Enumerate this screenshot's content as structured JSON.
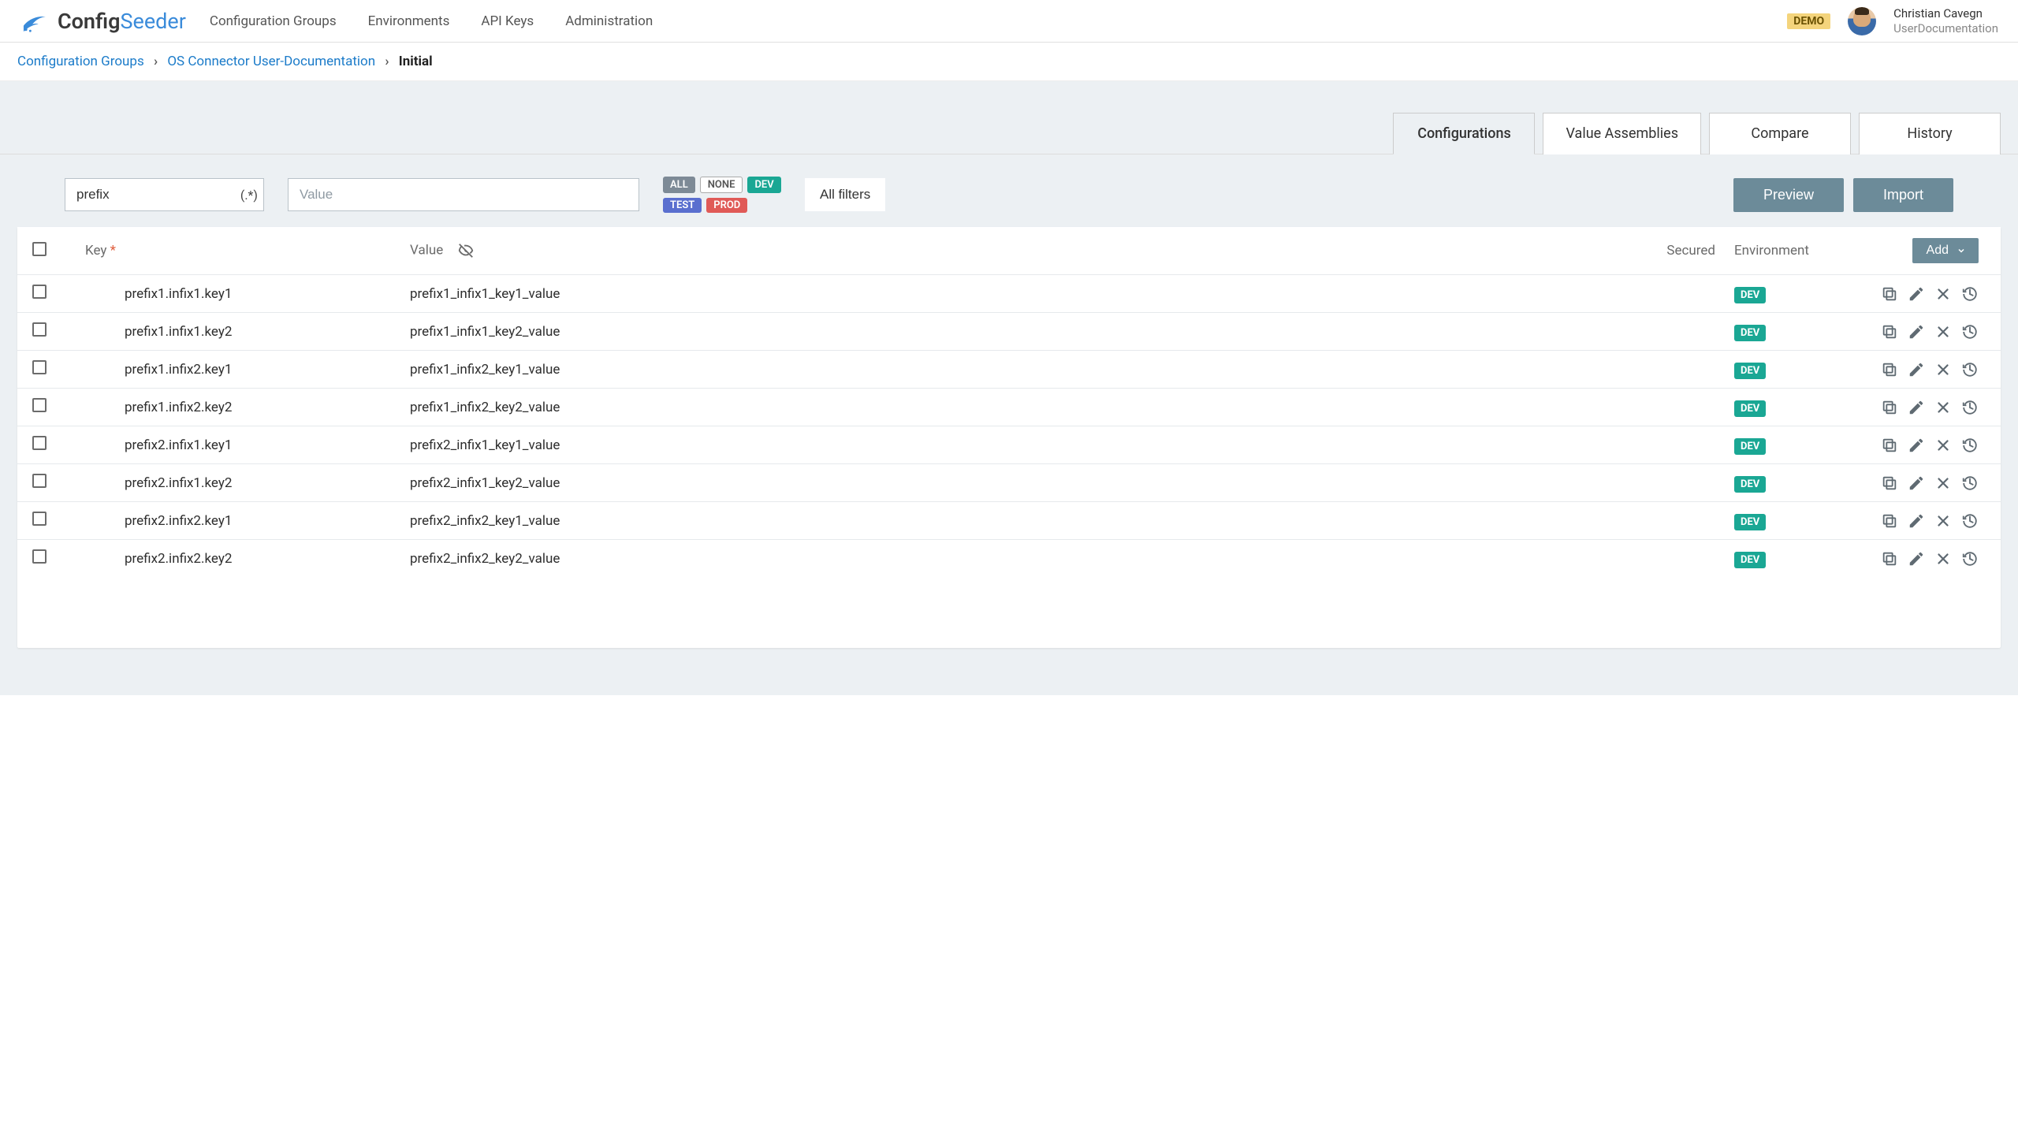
{
  "brand": {
    "name_a": "Config",
    "name_b": "Seeder"
  },
  "nav": {
    "items": [
      "Configuration Groups",
      "Environments",
      "API Keys",
      "Administration"
    ]
  },
  "header": {
    "demo": "DEMO",
    "user_name": "Christian Cavegn",
    "user_sub": "UserDocumentation"
  },
  "breadcrumb": {
    "a": "Configuration Groups",
    "b": "OS Connector User-Documentation",
    "c": "Initial"
  },
  "tabs": [
    "Configurations",
    "Value Assemblies",
    "Compare",
    "History"
  ],
  "filters": {
    "key_value": "prefix",
    "regex": "(.*)",
    "value_placeholder": "Value",
    "chips": {
      "all": "ALL",
      "none": "NONE",
      "dev": "DEV",
      "test": "TEST",
      "prod": "PROD"
    },
    "all_filters": "All filters",
    "preview": "Preview",
    "import": "Import"
  },
  "table": {
    "headers": {
      "key": "Key",
      "value": "Value",
      "secured": "Secured",
      "environment": "Environment",
      "add": "Add"
    },
    "rows": [
      {
        "key": "prefix1.infix1.key1",
        "value": "prefix1_infix1_key1_value",
        "env": "DEV"
      },
      {
        "key": "prefix1.infix1.key2",
        "value": "prefix1_infix1_key2_value",
        "env": "DEV"
      },
      {
        "key": "prefix1.infix2.key1",
        "value": "prefix1_infix2_key1_value",
        "env": "DEV"
      },
      {
        "key": "prefix1.infix2.key2",
        "value": "prefix1_infix2_key2_value",
        "env": "DEV"
      },
      {
        "key": "prefix2.infix1.key1",
        "value": "prefix2_infix1_key1_value",
        "env": "DEV"
      },
      {
        "key": "prefix2.infix1.key2",
        "value": "prefix2_infix1_key2_value",
        "env": "DEV"
      },
      {
        "key": "prefix2.infix2.key1",
        "value": "prefix2_infix2_key1_value",
        "env": "DEV"
      },
      {
        "key": "prefix2.infix2.key2",
        "value": "prefix2_infix2_key2_value",
        "env": "DEV"
      }
    ]
  }
}
